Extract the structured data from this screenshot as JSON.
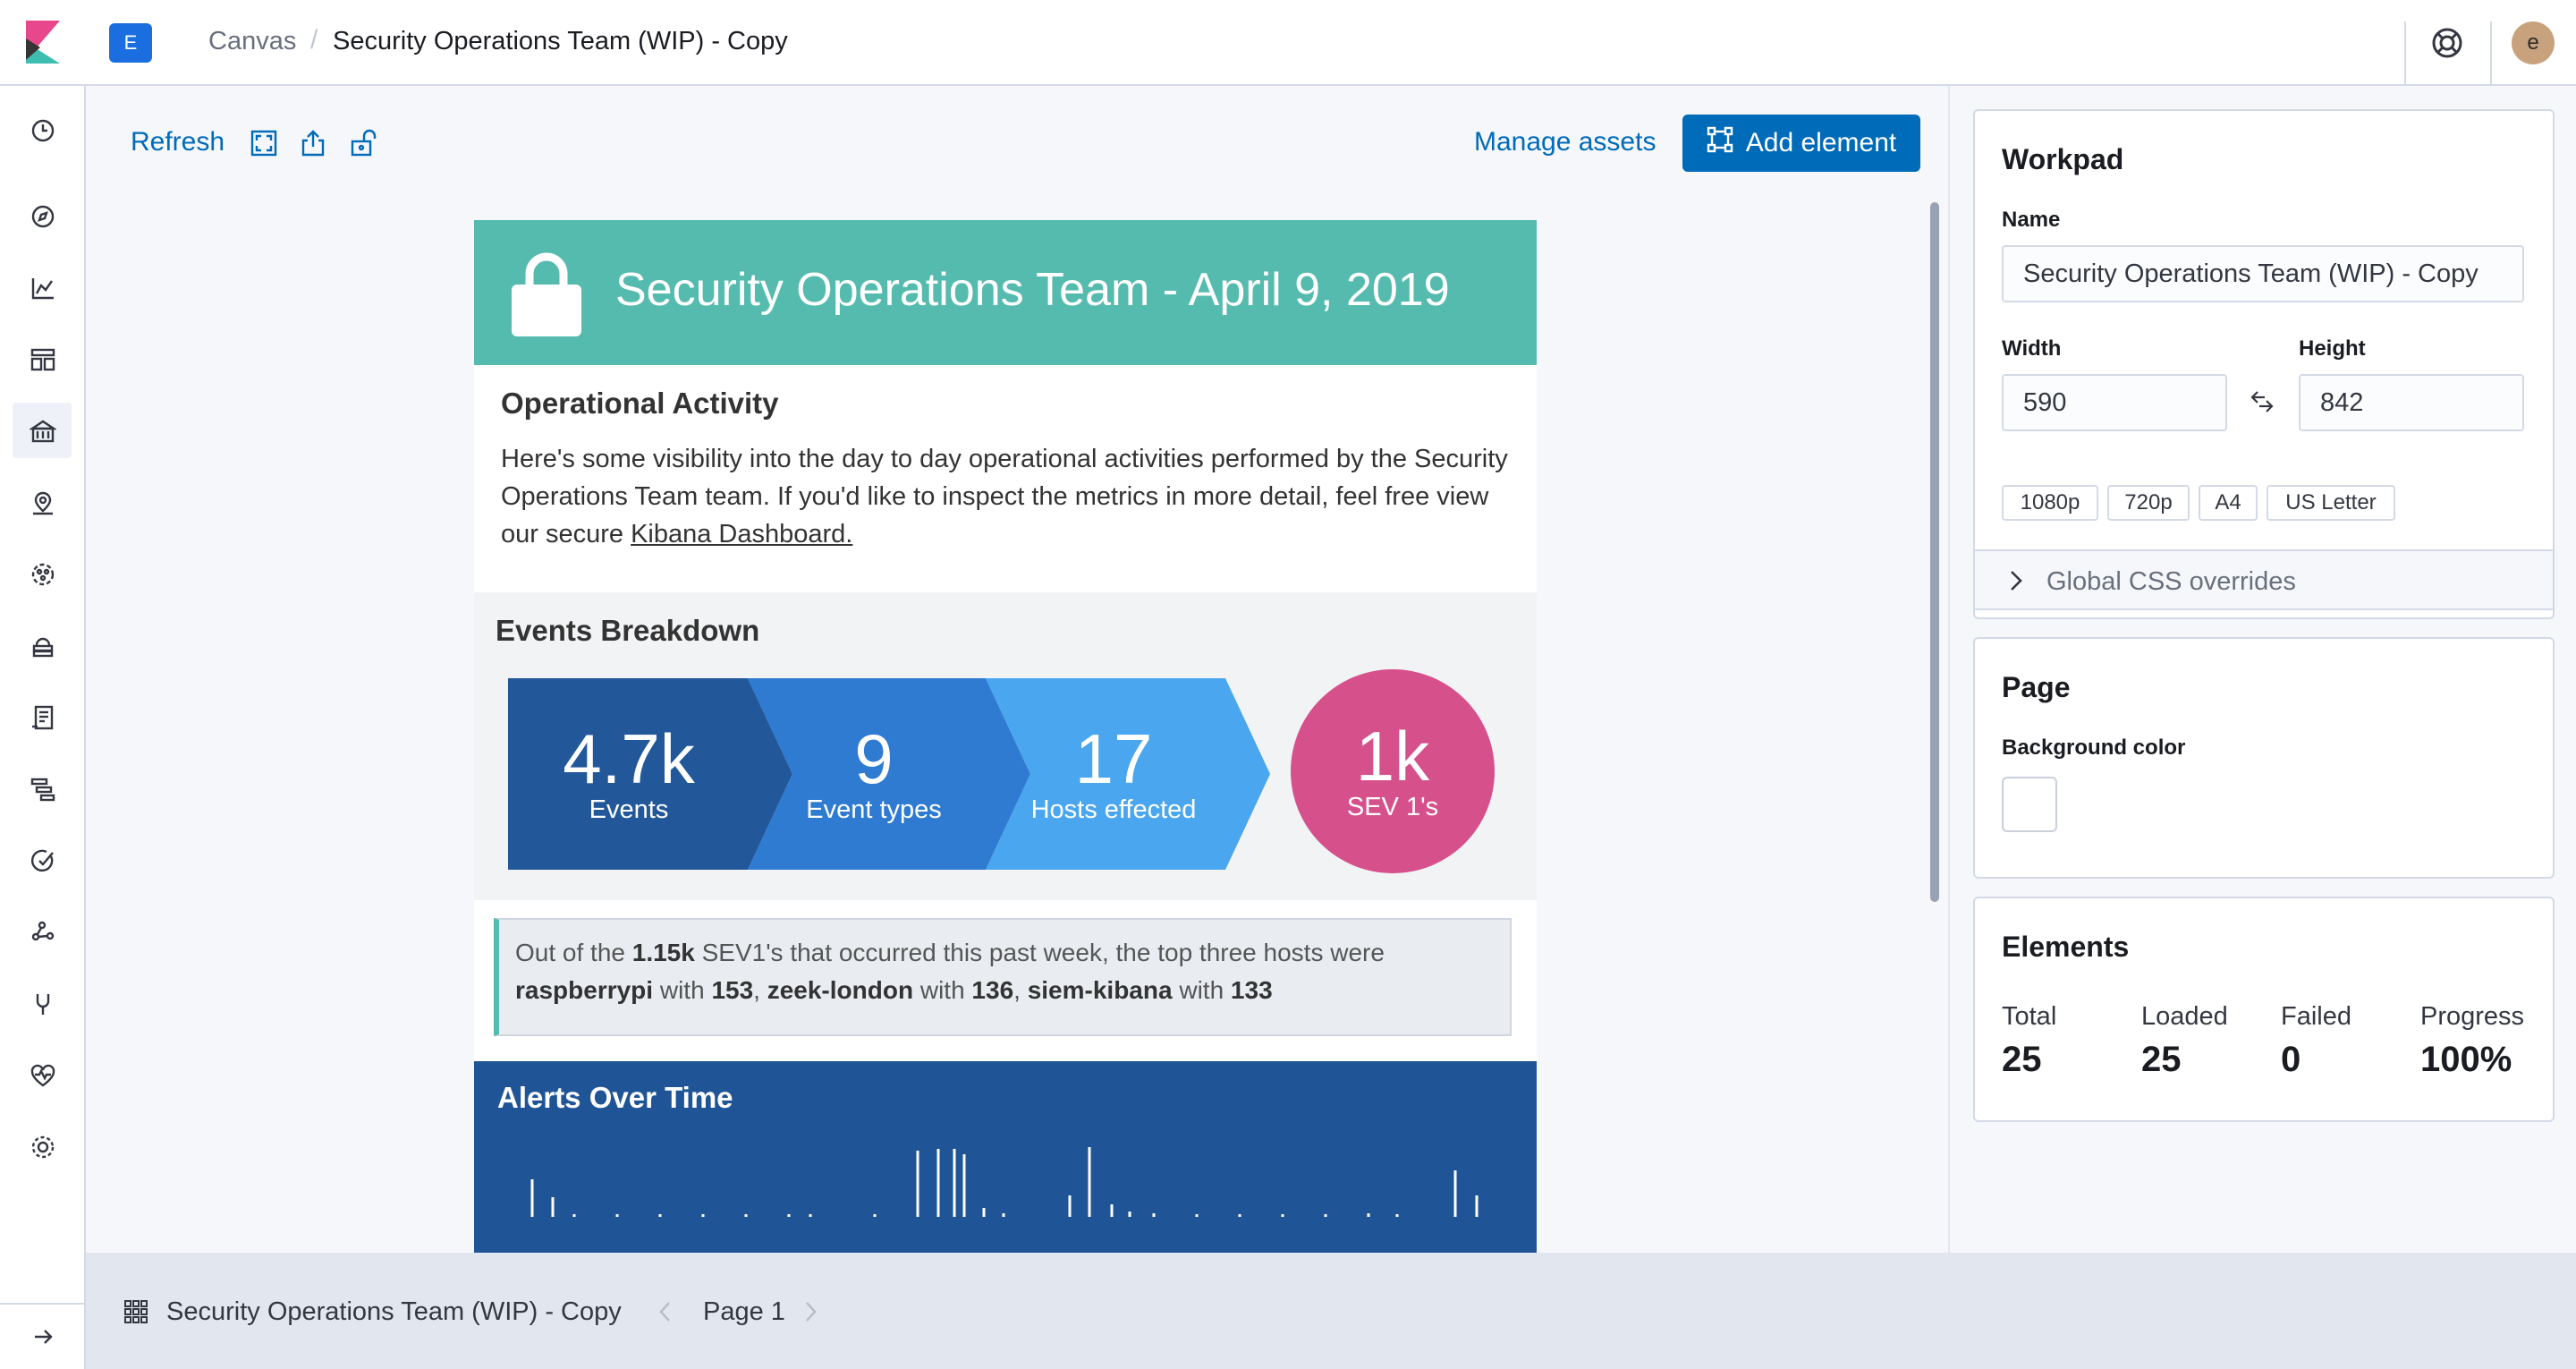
{
  "header": {
    "space_initial": "E",
    "breadcrumb_app": "Canvas",
    "breadcrumb_sep": "/",
    "breadcrumb_current": "Security Operations Team (WIP) - Copy",
    "user_initial": "e"
  },
  "toolbar": {
    "refresh_label": "Refresh",
    "manage_assets_label": "Manage assets",
    "add_element_label": "Add element"
  },
  "workpad": {
    "header_title": "Security Operations Team - April 9, 2019",
    "activity_title": "Operational Activity",
    "activity_text": "Here's some visibility into the day to day operational activities performed by the Security Operations Team team. If you'd like to inspect the metrics in more detail, feel free view our secure ",
    "activity_link": "Kibana Dashboard.",
    "breakdown_title": "Events Breakdown",
    "metrics": [
      {
        "value": "4.7k",
        "label": "Events"
      },
      {
        "value": "9",
        "label": "Event types"
      },
      {
        "value": "17",
        "label": "Hosts effected"
      },
      {
        "value": "1k",
        "label": "SEV 1's"
      }
    ],
    "callout": {
      "p1": "Out of the ",
      "count": "1.15k",
      "p2": " SEV1's that occurred this past week, the top three hosts were ",
      "host1": "raspberrypi",
      "w1": " with ",
      "n1": "153",
      "c1": ", ",
      "host2": "zeek-london",
      "w2": " with ",
      "n2": "136",
      "c2": ", ",
      "host3": "siem-kibana",
      "w3": " with ",
      "n3": "133"
    },
    "alerts_title": "Alerts Over Time",
    "colors": {
      "header": "#55bbae",
      "chevron1": "#22589a",
      "chevron2": "#2f7bd1",
      "chevron3": "#4aa6ee",
      "circle": "#d6508c",
      "alerts_bg": "#1f5596"
    }
  },
  "sidebar": {
    "workpad": {
      "title": "Workpad",
      "name_label": "Name",
      "name_value": "Security Operations Team (WIP) - Copy",
      "width_label": "Width",
      "width_value": "590",
      "height_label": "Height",
      "height_value": "842",
      "presets": [
        "1080p",
        "720p",
        "A4",
        "US Letter"
      ],
      "css_overrides_label": "Global CSS overrides"
    },
    "page": {
      "title": "Page",
      "bg_label": "Background color",
      "bg_value": "#ffffff"
    },
    "elements": {
      "title": "Elements",
      "stats": [
        {
          "label": "Total",
          "value": "25"
        },
        {
          "label": "Loaded",
          "value": "25"
        },
        {
          "label": "Failed",
          "value": "0"
        },
        {
          "label": "Progress",
          "value": "100%"
        }
      ]
    }
  },
  "footer": {
    "workpad_name": "Security Operations Team (WIP) - Copy",
    "page_label": "Page 1"
  },
  "nav_icons": [
    "clock-icon",
    "compass-icon",
    "visualize-icon",
    "dashboard-icon",
    "canvas-icon",
    "maps-icon",
    "ml-icon",
    "infrastructure-icon",
    "logs-icon",
    "apm-icon",
    "uptime-icon",
    "graph-icon",
    "devtools-icon",
    "monitoring-icon",
    "management-icon",
    "expand-nav-icon"
  ]
}
